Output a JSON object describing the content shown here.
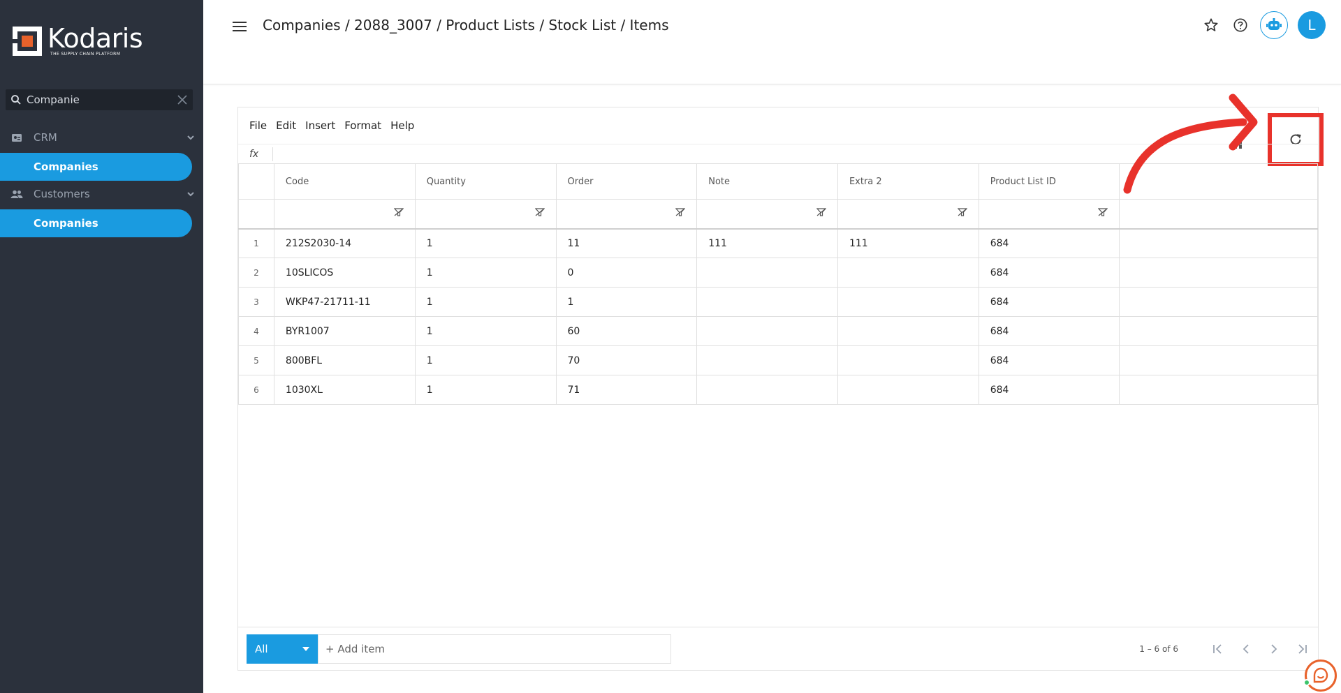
{
  "sidebar": {
    "logo_word": "Kodaris",
    "logo_tagline": "THE SUPPLY CHAIN PLATFORM",
    "search_value": "Companie",
    "groups": [
      {
        "label": "CRM",
        "icon": "contact-card-icon",
        "item": "Companies"
      },
      {
        "label": "Customers",
        "icon": "people-icon",
        "item": "Companies"
      }
    ]
  },
  "header": {
    "breadcrumb": "Companies / 2088_3007 / Product Lists / Stock List / Items",
    "avatar_initial": "L"
  },
  "sheet": {
    "menu": [
      "File",
      "Edit",
      "Insert",
      "Format",
      "Help"
    ],
    "fx_label": "fx",
    "columns": [
      "Code",
      "Quantity",
      "Order",
      "Note",
      "Extra 2",
      "Product List ID"
    ],
    "rows": [
      {
        "num": "1",
        "cells": [
          "212S2030-14",
          "1",
          "11",
          "111",
          "111",
          "684"
        ]
      },
      {
        "num": "2",
        "cells": [
          "10SLICOS",
          "1",
          "0",
          "",
          "",
          "684"
        ]
      },
      {
        "num": "3",
        "cells": [
          "WKP47-21711-11",
          "1",
          "1",
          "",
          "",
          "684"
        ]
      },
      {
        "num": "4",
        "cells": [
          "BYR1007",
          "1",
          "60",
          "",
          "",
          "684"
        ]
      },
      {
        "num": "5",
        "cells": [
          "800BFL",
          "1",
          "70",
          "",
          "",
          "684"
        ]
      },
      {
        "num": "6",
        "cells": [
          "1030XL",
          "1",
          "71",
          "",
          "",
          "684"
        ]
      }
    ]
  },
  "footer": {
    "filter_value": "All",
    "add_item_label": "+ Add item",
    "pager_text": "1 – 6 of 6"
  },
  "colors": {
    "accent": "#1a9be0",
    "sidebar_bg": "#2b313c",
    "annotation": "#e8322b"
  }
}
